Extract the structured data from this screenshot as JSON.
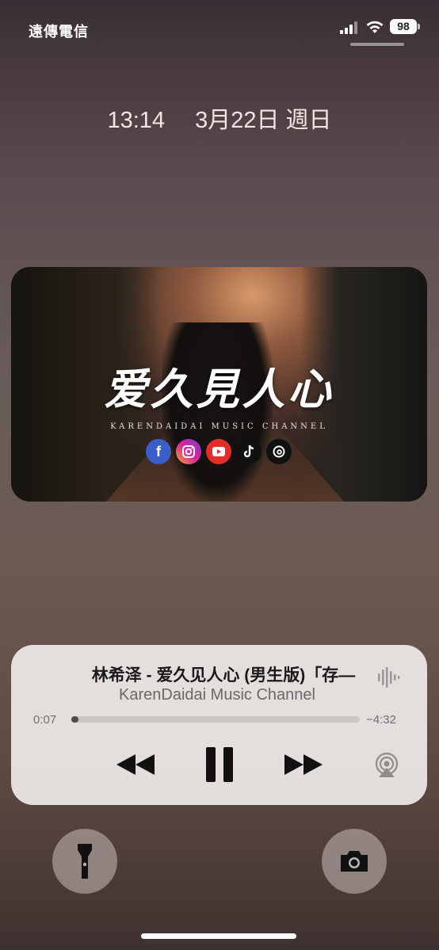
{
  "status": {
    "carrier": "遠傳電信",
    "battery": "98"
  },
  "lock": {
    "time": "13:14",
    "date": "3月22日 週日"
  },
  "artwork": {
    "title": "爱久見人心",
    "subtitle": "KARENDAIDAI MUSIC CHANNEL",
    "icons": [
      "facebook-icon",
      "instagram-icon",
      "youtube-icon",
      "tiktok-icon",
      "threads-icon"
    ]
  },
  "player": {
    "title": "林希泽 - 爱久见人心 (男生版)「存—",
    "artist": "KarenDaidai Music Channel",
    "elapsed": "0:07",
    "remaining": "−4:32",
    "progress": 0.026
  },
  "colors": {
    "player_bg": "#eeeae8",
    "accent": "#ffffff"
  }
}
